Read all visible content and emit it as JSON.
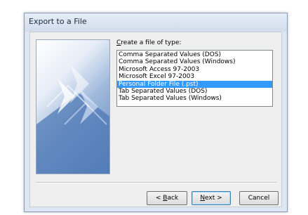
{
  "dialog": {
    "title": "Export to a File",
    "prompt_prefix": "",
    "prompt_mnemonic": "C",
    "prompt_rest": "reate a file of type:",
    "file_types": [
      "Comma Separated Values (DOS)",
      "Comma Separated Values (Windows)",
      "Microsoft Access 97-2003",
      "Microsoft Excel 97-2003",
      "Personal Folder File (.pst)",
      "Tab Separated Values (DOS)",
      "Tab Separated Values (Windows)"
    ],
    "selected_index": 4,
    "buttons": {
      "back_prefix": "< ",
      "back_mnemonic": "B",
      "back_rest": "ack",
      "next_prefix": "",
      "next_mnemonic": "N",
      "next_rest": "ext >",
      "cancel": "Cancel"
    }
  },
  "colors": {
    "selection": "#3399ff",
    "dialog_bg": "#dde6f2",
    "wizard_blue": "#5d86bf"
  },
  "icons": {
    "wizard_art": "wizard-arrows-graphic"
  }
}
